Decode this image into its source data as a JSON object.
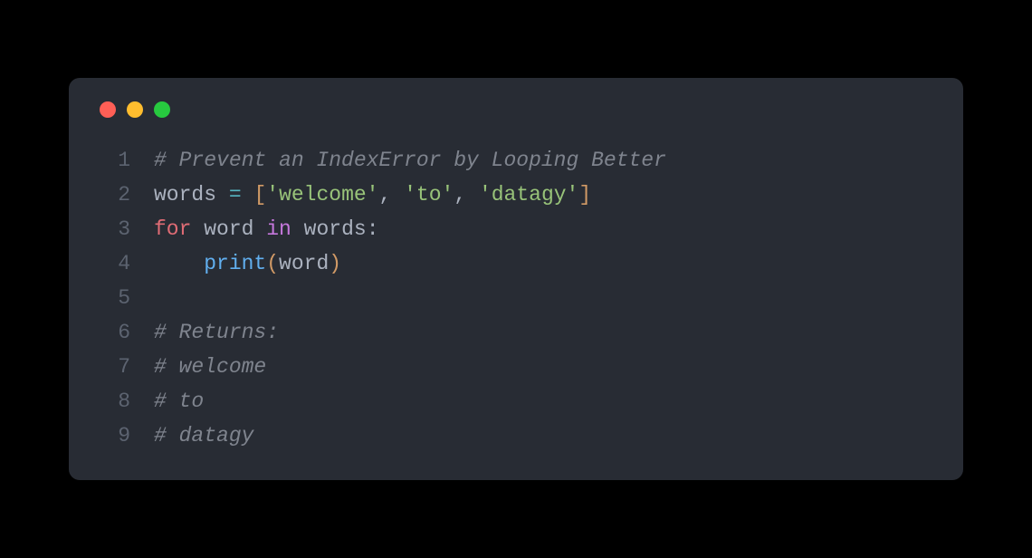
{
  "code": {
    "language": "python",
    "lines": [
      {
        "num": "1",
        "tokens": [
          {
            "class": "tok-comment",
            "text": "# Prevent an IndexError by Looping Better"
          }
        ]
      },
      {
        "num": "2",
        "tokens": [
          {
            "class": "tok-identifier",
            "text": "words "
          },
          {
            "class": "tok-op2",
            "text": "="
          },
          {
            "class": "tok-identifier",
            "text": " "
          },
          {
            "class": "tok-bracket",
            "text": "["
          },
          {
            "class": "tok-string",
            "text": "'welcome'"
          },
          {
            "class": "tok-punct",
            "text": ", "
          },
          {
            "class": "tok-string",
            "text": "'to'"
          },
          {
            "class": "tok-punct",
            "text": ", "
          },
          {
            "class": "tok-string",
            "text": "'datagy'"
          },
          {
            "class": "tok-bracket",
            "text": "]"
          }
        ]
      },
      {
        "num": "3",
        "tokens": [
          {
            "class": "tok-keyword2",
            "text": "for"
          },
          {
            "class": "tok-identifier",
            "text": " word "
          },
          {
            "class": "tok-keyword",
            "text": "in"
          },
          {
            "class": "tok-identifier",
            "text": " words"
          },
          {
            "class": "tok-punct",
            "text": ":"
          }
        ]
      },
      {
        "num": "4",
        "tokens": [
          {
            "class": "tok-identifier",
            "text": "    "
          },
          {
            "class": "tok-builtin",
            "text": "print"
          },
          {
            "class": "tok-bracket",
            "text": "("
          },
          {
            "class": "tok-identifier",
            "text": "word"
          },
          {
            "class": "tok-bracket",
            "text": ")"
          }
        ]
      },
      {
        "num": "5",
        "tokens": []
      },
      {
        "num": "6",
        "tokens": [
          {
            "class": "tok-comment",
            "text": "# Returns:"
          }
        ]
      },
      {
        "num": "7",
        "tokens": [
          {
            "class": "tok-comment",
            "text": "# welcome"
          }
        ]
      },
      {
        "num": "8",
        "tokens": [
          {
            "class": "tok-comment",
            "text": "# to"
          }
        ]
      },
      {
        "num": "9",
        "tokens": [
          {
            "class": "tok-comment",
            "text": "# datagy"
          }
        ]
      }
    ]
  },
  "window": {
    "controls": [
      "close",
      "minimize",
      "maximize"
    ]
  }
}
